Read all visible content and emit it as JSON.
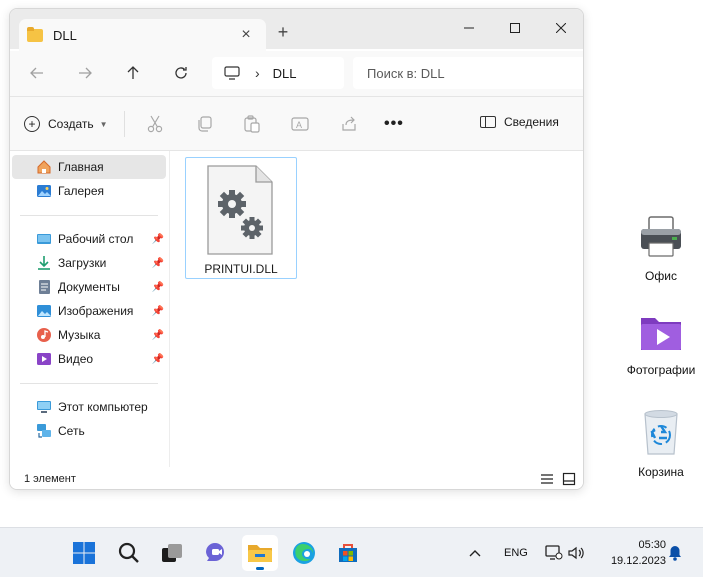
{
  "window": {
    "tab_title": "DLL",
    "new_tab_icon": "plus-icon",
    "tab_close_icon": "close-icon",
    "controls": {
      "minimize_icon": "minimize-icon",
      "maximize_icon": "maximize-icon",
      "close_icon": "close-icon"
    }
  },
  "address": {
    "path_segment": "DLL",
    "search_placeholder": "Поиск в: DLL"
  },
  "toolbar": {
    "create_label": "Создать",
    "details_label": "Сведения"
  },
  "sidebar": {
    "items": [
      {
        "label": "Главная",
        "icon": "home-icon",
        "pinned": false
      },
      {
        "label": "Галерея",
        "icon": "gallery-icon",
        "pinned": false
      },
      {
        "label": "Рабочий стол",
        "icon": "desktop-icon",
        "pinned": true
      },
      {
        "label": "Загрузки",
        "icon": "download-icon",
        "pinned": true
      },
      {
        "label": "Документы",
        "icon": "documents-icon",
        "pinned": true
      },
      {
        "label": "Изображения",
        "icon": "pictures-icon",
        "pinned": true
      },
      {
        "label": "Музыка",
        "icon": "music-icon",
        "pinned": true
      },
      {
        "label": "Видео",
        "icon": "video-icon",
        "pinned": true
      },
      {
        "label": "Этот компьютер",
        "icon": "computer-icon",
        "pinned": false
      },
      {
        "label": "Сеть",
        "icon": "network-icon",
        "pinned": false
      }
    ]
  },
  "files": [
    {
      "name": "PRINTUI.DLL",
      "icon": "dll-file-icon"
    }
  ],
  "status": {
    "item_count": "1 элемент"
  },
  "desktop_icons": [
    {
      "label": "Офис",
      "icon": "printer-icon"
    },
    {
      "label": "Фотографии",
      "icon": "video-folder-icon"
    },
    {
      "label": "Корзина",
      "icon": "recycle-bin-icon"
    }
  ],
  "taskbar": {
    "language": "ENG",
    "time": "05:30",
    "date": "19.12.2023"
  },
  "colors": {
    "accent": "#0067c0",
    "selection_border": "#99d1ff",
    "folder_yellow": "#f6c344"
  }
}
